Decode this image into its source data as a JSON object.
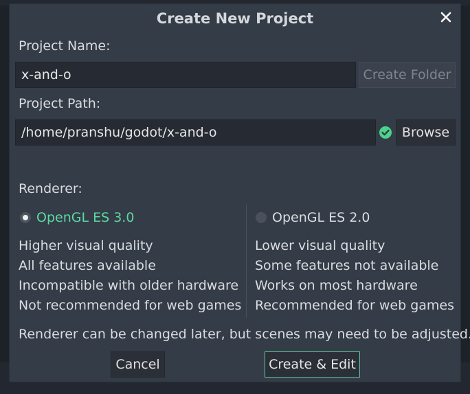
{
  "dialog": {
    "title": "Create New Project",
    "close_icon": "close-icon"
  },
  "project_name": {
    "label": "Project Name:",
    "value": "x-and-o",
    "create_folder_label": "Create Folder"
  },
  "project_path": {
    "label": "Project Path:",
    "value": "/home/pranshu/godot/x-and-o",
    "status_icon": "check-circle-icon",
    "browse_label": "Browse"
  },
  "renderer": {
    "label": "Renderer:",
    "options": [
      {
        "label": "OpenGL ES 3.0",
        "selected": true,
        "features": [
          "Higher visual quality",
          "All features available",
          "Incompatible with older hardware",
          "Not recommended for web games"
        ]
      },
      {
        "label": "OpenGL ES 2.0",
        "selected": false,
        "features": [
          "Lower visual quality",
          "Some features not available",
          "Works on most hardware",
          "Recommended for web games"
        ]
      }
    ],
    "note": "Renderer can be changed later, but scenes may need to be adjusted."
  },
  "actions": {
    "cancel_label": "Cancel",
    "create_label": "Create & Edit"
  },
  "colors": {
    "accent": "#63c39a",
    "selected_text": "#5dd9a0",
    "dialog_bg": "#343c47",
    "check_green": "#4bd38a"
  }
}
